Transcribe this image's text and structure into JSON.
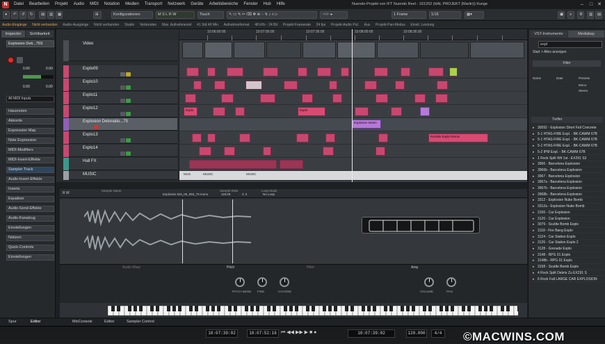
{
  "menu": {
    "items": [
      "Datei",
      "Bearbeiten",
      "Projekt",
      "Audio",
      "MIDI",
      "Notation",
      "Medien",
      "Transport",
      "Netzwerk",
      "Geräte",
      "Arbeitsbereiche",
      "Fenster",
      "Hub",
      "Hilfe"
    ]
  },
  "window_title": "Nuendo-Projekt von IFT Nuendo Reel - 161202 (HAL PROJEKT (Marlin)) Kunge",
  "toolbar": {
    "mode": "Konfigurationen",
    "snap": "Raster",
    "quantize": "1 Frame",
    "link": "1/16",
    "touch": "Touch"
  },
  "status": {
    "items": [
      "Audio-Eingänge",
      "Nicht verbunden",
      "Audio-Ausgänge",
      "Nicht verbunden",
      "Studio",
      "Verbunden",
      "Max. Aufnahmezeit",
      "41 Std 49 Min",
      "Aufnahmeformat",
      "48 kHz - 24 Bit",
      "Projekt-Framerate",
      "24 fps",
      "Projekt-Audio Pul.",
      "Aus",
      "Projekt-Pan-Modus",
      "Einstl. Leistung"
    ]
  },
  "left": {
    "tabs": [
      "Inspector",
      "Sichtbarkeit"
    ],
    "track": "Explosion Deti...75S",
    "midi_in": "All MIDI Inputs",
    "sections": [
      "Hausnoten",
      "Akkorde",
      "Expression Map",
      "Note Expression",
      "MIDI-Modifiers",
      "MIDI-Insert-Effekte",
      "Sampler Track",
      "Audio-Insert-Effekte",
      "Inserts",
      "Equalizer",
      "Audio-Send-Effekte",
      "Audio-Kanalzug",
      "Einstellungen",
      "Notizen",
      "Quick-Controls",
      "Einstellungen"
    ],
    "meter_vals": [
      "0.00",
      "0.00"
    ],
    "fader_vals": [
      "0.00",
      "0.00"
    ]
  },
  "tracks": [
    {
      "name": "Video"
    },
    {
      "name": "Explo09"
    },
    {
      "name": "Explo10"
    },
    {
      "name": "Explo11"
    },
    {
      "name": "Explo12"
    },
    {
      "name": "Explosion Detonatio...75"
    },
    {
      "name": "Explo13"
    },
    {
      "name": "Explo14"
    },
    {
      "name": "Hall FX"
    },
    {
      "name": "MUSIC"
    }
  ],
  "ruler": {
    "times": [
      "10:06:00:00",
      "10:07:00:00",
      "10:07:36:00",
      "10:08:00:00",
      "10:08:36:00"
    ]
  },
  "event_labels": [
    "Explo",
    "Explo",
    "Explo",
    "Explo",
    "Explo",
    "Explosion Deton",
    "Rumble Explo Remix",
    "Explo"
  ],
  "music_labels": [
    "MUS",
    "MUSIC",
    "MUSIC"
  ],
  "right": {
    "tabs": [
      "VST-Instrumente",
      "Mediabay"
    ],
    "search": "expl",
    "filter": "Start > Alles anzeigen",
    "filter_header": "Filter",
    "col_labels": [
      "Name",
      "Date",
      "Preview"
    ],
    "attrs": [
      "Mono",
      "Stereo"
    ],
    "list_header": "Treffer",
    "items": [
      "30092 - Explosion Short Fall Concrete",
      "5-1 HTAS-FIRE Expl. - BK-CAWM 67B",
      "5-1 HTAS-FIRE Expl. - BK-CAWM 67B",
      "5-1 HTAS-FIRE Expl. - BK-CAWM 67B",
      "5-2 IPM Expl. - BK-CAWM 67B",
      "1 Rock Split Wit 1st - EX291 S3",
      "3966 - Barcelona Explosion",
      "3966b - Barcelona Explosion",
      "3967 - Barcelona Explosion",
      "3967a - Barcelona Explosion",
      "3967b - Barcelona Explosion",
      "3968b - Barcelona Explosion",
      "3312 - Explosion Nuke Bomb",
      "3312a - Explosion Nuke Bomb",
      "3156 - Car Explosion",
      "3126 - Car Explosion",
      "3079 - Scuttle Bomb Explo",
      "3118 - Fire Bang Explo",
      "3124 - Car Station Explo",
      "3126 - Car Station Explo 2",
      "3128 - Grenade Explo",
      "3148 - RPG 01 Explo",
      "3148b - RPG 01 Explo",
      "3158 - Scuttle Bomb Explo",
      "4 Rock Split Debris Zu EX291 S",
      "6 Rock Fall LARGE CAR EXPLOSION"
    ]
  },
  "editor": {
    "labels": [
      "Sample Name",
      "Explosion Det_06_083_75 mono",
      "Sample-Rate",
      "119.00",
      "C 3",
      "Loop Mode",
      "No Loop"
    ],
    "sections": [
      "Pitch",
      "Amp",
      "Filter",
      "Audio Warp"
    ],
    "knobs": [
      "PITCH BEND",
      "FINE",
      "COARSE",
      "VOLUME",
      "PAN"
    ]
  },
  "bottom_tabs": [
    "Spur",
    "Editor",
    "MixConsole",
    "Editor",
    "Sampler Control"
  ],
  "transport": {
    "pos1": "10:07:39:02",
    "pos2": "10:07:52:16",
    "pos3": "10:07:39:02",
    "tempo": "120.000",
    "sig": "4/4"
  },
  "watermark": "©MACWINS.COM",
  "colors": {
    "event": "#c8476f",
    "selected_event": "#b57ad8",
    "track_header": "#34383c",
    "accent": "#e0a84a"
  }
}
